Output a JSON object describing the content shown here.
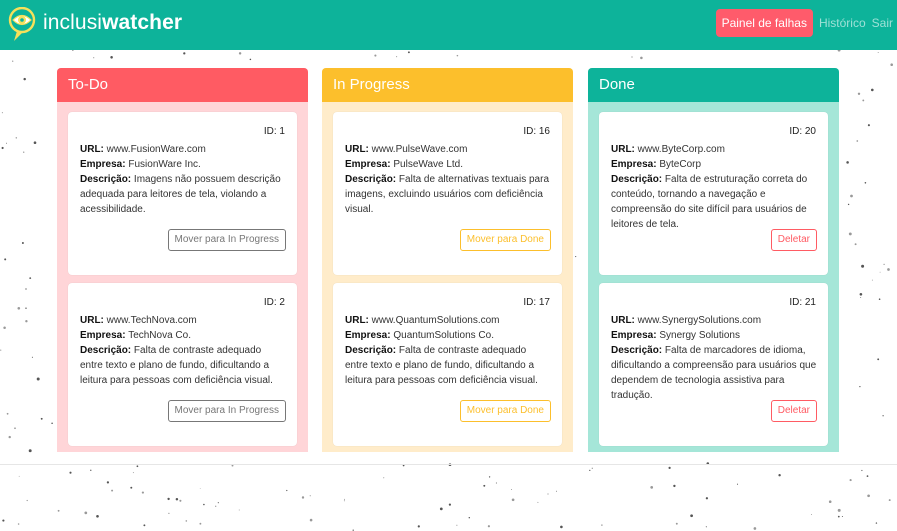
{
  "app": {
    "brand_light": "inclusi",
    "brand_bold": "watcher"
  },
  "nav": {
    "items": [
      "Painel de falhas",
      "Histórico",
      "Sair"
    ]
  },
  "columns": [
    {
      "title": "To-Do",
      "header_color": "#ff5b63",
      "body_color": "#ffd5d8",
      "cards": [
        {
          "id": "ID: 1",
          "url_label": "URL:",
          "url": "www.FusionWare.com",
          "empresa_label": "Empresa:",
          "empresa": "FusionWare Inc.",
          "desc_label": "Descrição:",
          "desc": "Imagens não possuem descrição adequada para leitores de tela, violando a acessibilidade.",
          "button": "Mover para In Progress"
        },
        {
          "id": "ID: 2",
          "url_label": "URL:",
          "url": "www.TechNova.com",
          "empresa_label": "Empresa:",
          "empresa": "TechNova Co.",
          "desc_label": "Descrição:",
          "desc": "Falta de contraste adequado entre texto e plano de fundo, dificultando a leitura para pessoas com deficiência visual.",
          "button": "Mover para In Progress"
        }
      ]
    },
    {
      "title": "In Progress",
      "header_color": "#fcbf2c",
      "body_color": "#ffecca",
      "cards": [
        {
          "id": "ID: 16",
          "url_label": "URL:",
          "url": "www.PulseWave.com",
          "empresa_label": "Empresa:",
          "empresa": "PulseWave Ltd.",
          "desc_label": "Descrição:",
          "desc": "Falta de alternativas textuais para imagens, excluindo usuários com deficiência visual.",
          "button": "Mover para Done"
        },
        {
          "id": "ID: 17",
          "url_label": "URL:",
          "url": "www.QuantumSolutions.com",
          "empresa_label": "Empresa:",
          "empresa": "QuantumSolutions Co.",
          "desc_label": "Descrição:",
          "desc": "Falta de contraste adequado entre texto e plano de fundo, dificultando a leitura para pessoas com deficiência visual.",
          "button": "Mover para Done"
        }
      ]
    },
    {
      "title": "Done",
      "header_color": "#0db39a",
      "body_color": "#a5e6d8",
      "cards": [
        {
          "id": "ID: 20",
          "url_label": "URL:",
          "url": "www.ByteCorp.com",
          "empresa_label": "Empresa:",
          "empresa": "ByteCorp",
          "desc_label": "Descrição:",
          "desc": "Falta de estruturação correta do conteúdo, tornando a navegação e compreensão do site difícil para usuários de leitores de tela.",
          "button": "Deletar"
        },
        {
          "id": "ID: 21",
          "url_label": "URL:",
          "url": "www.SynergySolutions.com",
          "empresa_label": "Empresa:",
          "empresa": "Synergy Solutions",
          "desc_label": "Descrição:",
          "desc": "Falta de marcadores de idioma, dificultando a compreensão para usuários que dependem de tecnologia assistiva para tradução.",
          "button": "Deletar"
        }
      ]
    }
  ]
}
